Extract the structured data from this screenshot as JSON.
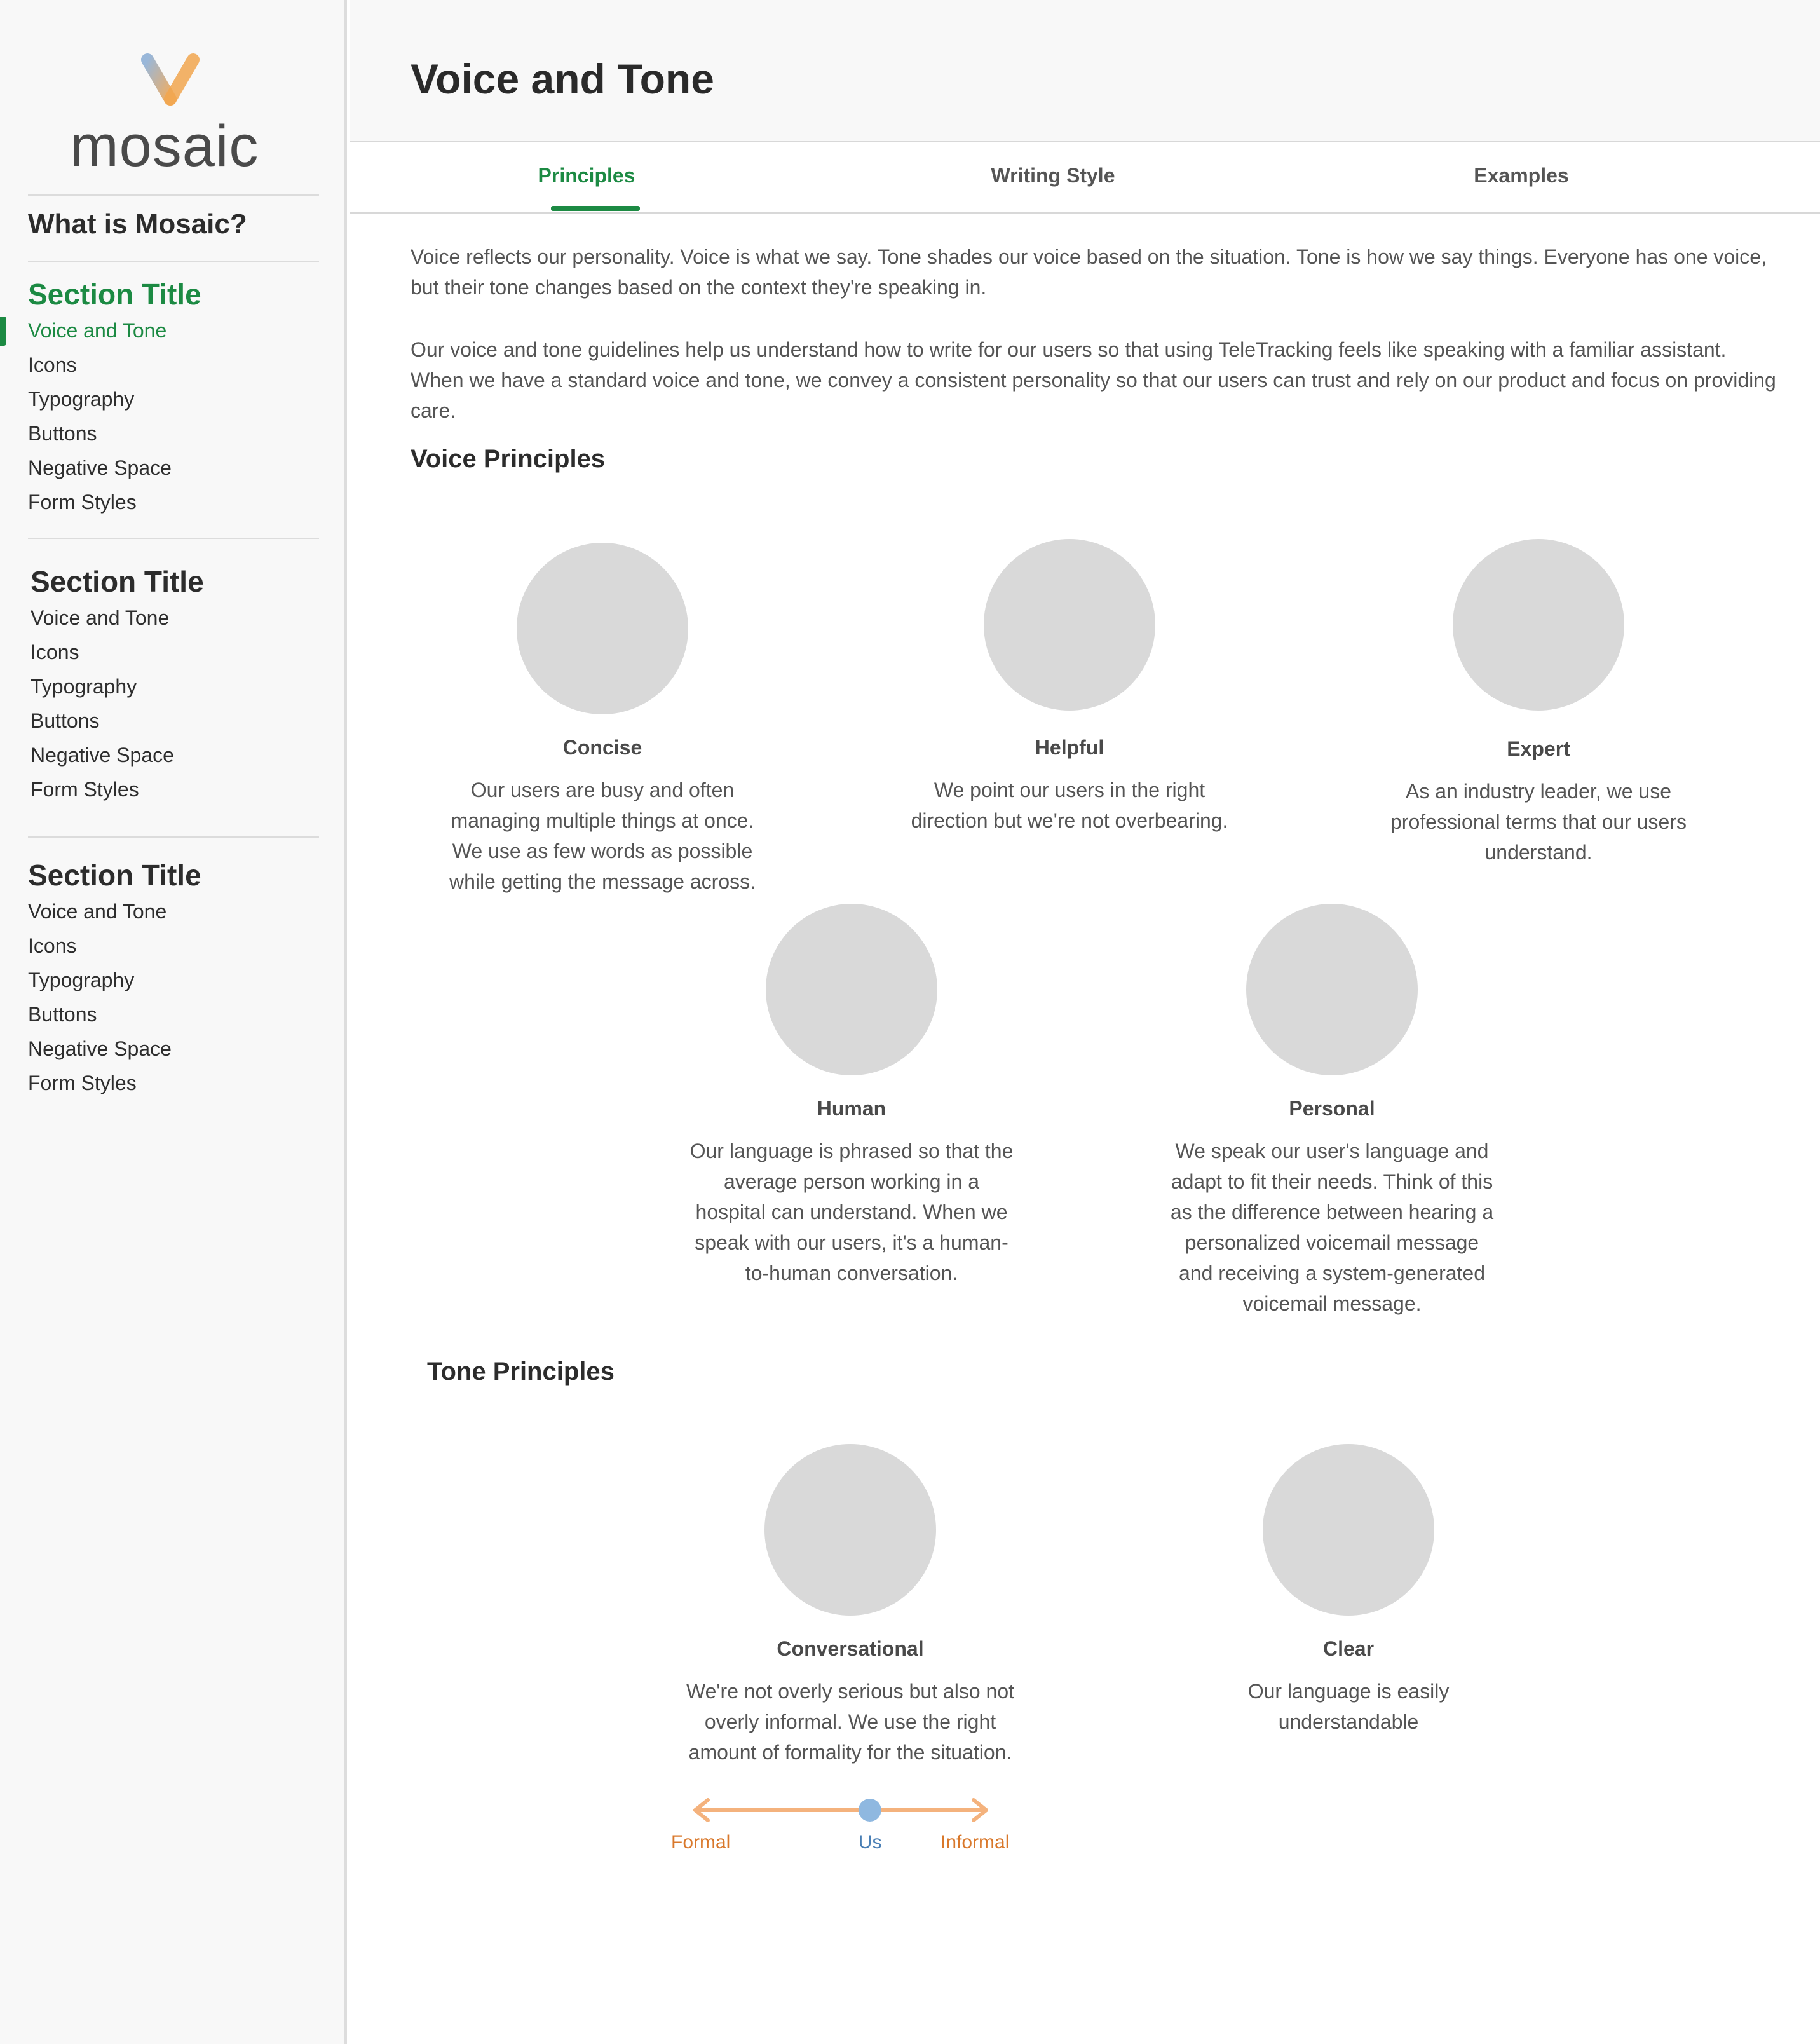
{
  "brand": {
    "name": "mosaic"
  },
  "sidebar": {
    "what_is": "What is Mosaic?",
    "sections": [
      {
        "title": "Section Title",
        "items": [
          "Voice and Tone",
          "Icons",
          "Typography",
          "Buttons",
          "Negative Space",
          "Form Styles"
        ]
      },
      {
        "title": "Section Title",
        "items": [
          "Voice and Tone",
          "Icons",
          "Typography",
          "Buttons",
          "Negative Space",
          "Form Styles"
        ]
      },
      {
        "title": "Section Title",
        "items": [
          "Voice and Tone",
          "Icons",
          "Typography",
          "Buttons",
          "Negative Space",
          "Form Styles"
        ]
      }
    ],
    "active_section": 0,
    "active_item": 0
  },
  "header": {
    "title": "Voice and Tone"
  },
  "tabs": [
    {
      "label": "Principles",
      "active": true
    },
    {
      "label": "Writing Style",
      "active": false
    },
    {
      "label": "Examples",
      "active": false
    }
  ],
  "intro": {
    "p1": "Voice reflects our personality. Voice is what we say. Tone shades our voice based on the situation. Tone is how we say things. Everyone has one voice, but their tone changes based on the context they're speaking in.",
    "p2": "Our voice and tone guidelines help us understand how to write for our users so that using TeleTracking feels like speaking with a familiar assistant. When we have a standard voice and tone, we convey a consistent personality so that our users can trust and rely on our product and focus on providing care."
  },
  "voice": {
    "heading": "Voice Principles",
    "principles": [
      {
        "title": "Concise",
        "desc": "Our users are busy and often managing multiple things at once. We use as few words as possible while getting the message across."
      },
      {
        "title": "Helpful",
        "desc": "We point our users in the right direction but we're not overbearing."
      },
      {
        "title": "Expert",
        "desc": "As an industry leader, we use professional terms that our users understand."
      },
      {
        "title": "Human",
        "desc": "Our language is phrased so that the average person working in a hospital can understand. When we speak with our users, it's a human-to-human conversation."
      },
      {
        "title": "Personal",
        "desc": "We speak our user's language and adapt to fit their needs. Think of this as the difference between hearing a personalized voicemail message and receiving a system-generated voicemail message."
      }
    ]
  },
  "tone": {
    "heading": "Tone Principles",
    "principles": [
      {
        "title": "Conversational",
        "desc": "We're not overly serious but also not overly informal. We use the right amount of formality for the situation."
      },
      {
        "title": "Clear",
        "desc": "Our language is easily understandable"
      }
    ],
    "scale": {
      "left": "Formal",
      "marker": "Us",
      "right": "Informal",
      "marker_position": 0.6,
      "arrow_color": "#f4b27d",
      "marker_color": "#8fb8e0",
      "end_label_color": "#d9782b",
      "marker_label_color": "#4a7fb5"
    }
  },
  "colors": {
    "accent": "#1c8a43",
    "placeholder_circle": "#d9d9d9"
  }
}
